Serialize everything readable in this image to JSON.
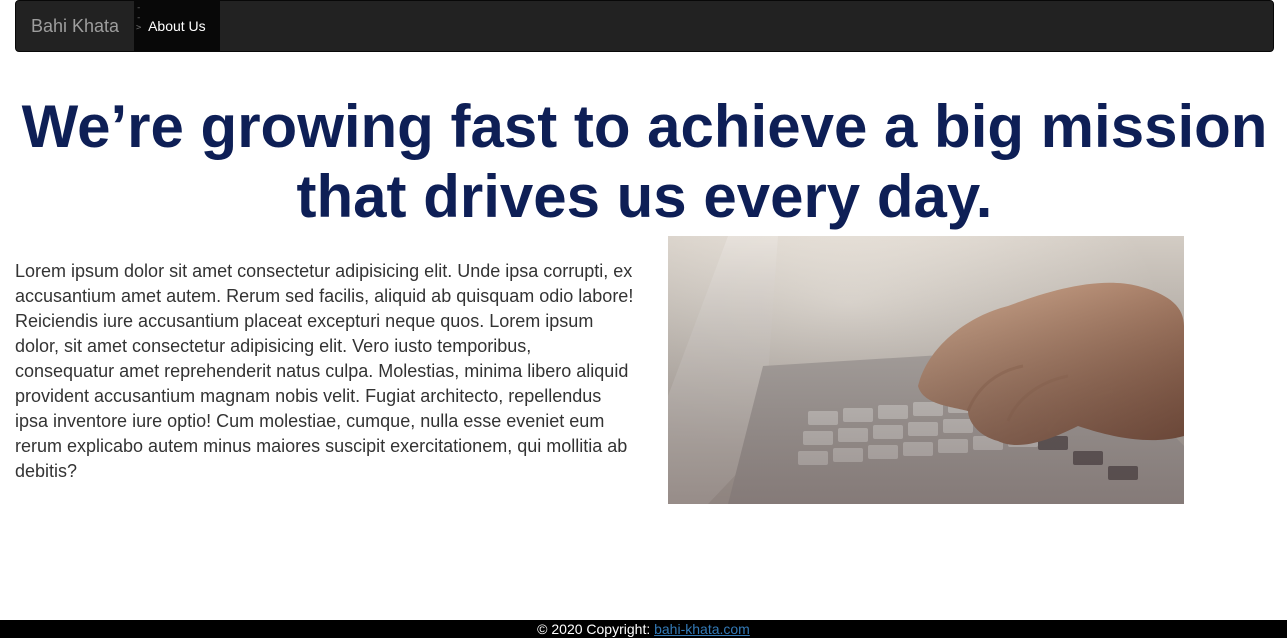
{
  "navbar": {
    "brand": "Bahi Khata",
    "brand_comment": "-->",
    "items": [
      {
        "label": "About Us",
        "active": true
      }
    ]
  },
  "hero": {
    "headline_line1": "We’re growing fast to achieve a big mission",
    "headline_line2": "that drives us every day."
  },
  "content": {
    "paragraph": "Lorem ipsum dolor sit amet consectetur adipisicing elit. Unde ipsa corrupti, ex accusantium amet autem. Rerum sed facilis, aliquid ab quisquam odio labore! Reiciendis iure accusantium placeat excepturi neque quos. Lorem ipsum dolor, sit amet consectetur adipisicing elit. Vero iusto temporibus, consequatur amet reprehenderit natus culpa. Molestias, minima libero aliquid provident accusantium magnam nobis velit. Fugiat architecto, repellendus ipsa inventore iure optio! Cum molestiae, cumque, nulla esse eveniet eum rerum explicabo autem minus maiores suscipit exercitationem, qui mollitia ab debitis?",
    "image_subject": "hands-typing-on-laptop"
  },
  "footer": {
    "copyright": "© 2020 Copyright: ",
    "link_text": "bahi-khata.com"
  },
  "colors": {
    "navbar_bg": "#222222",
    "headline": "#0e1f56",
    "footer_bg": "#000000",
    "link": "#337ab7"
  }
}
